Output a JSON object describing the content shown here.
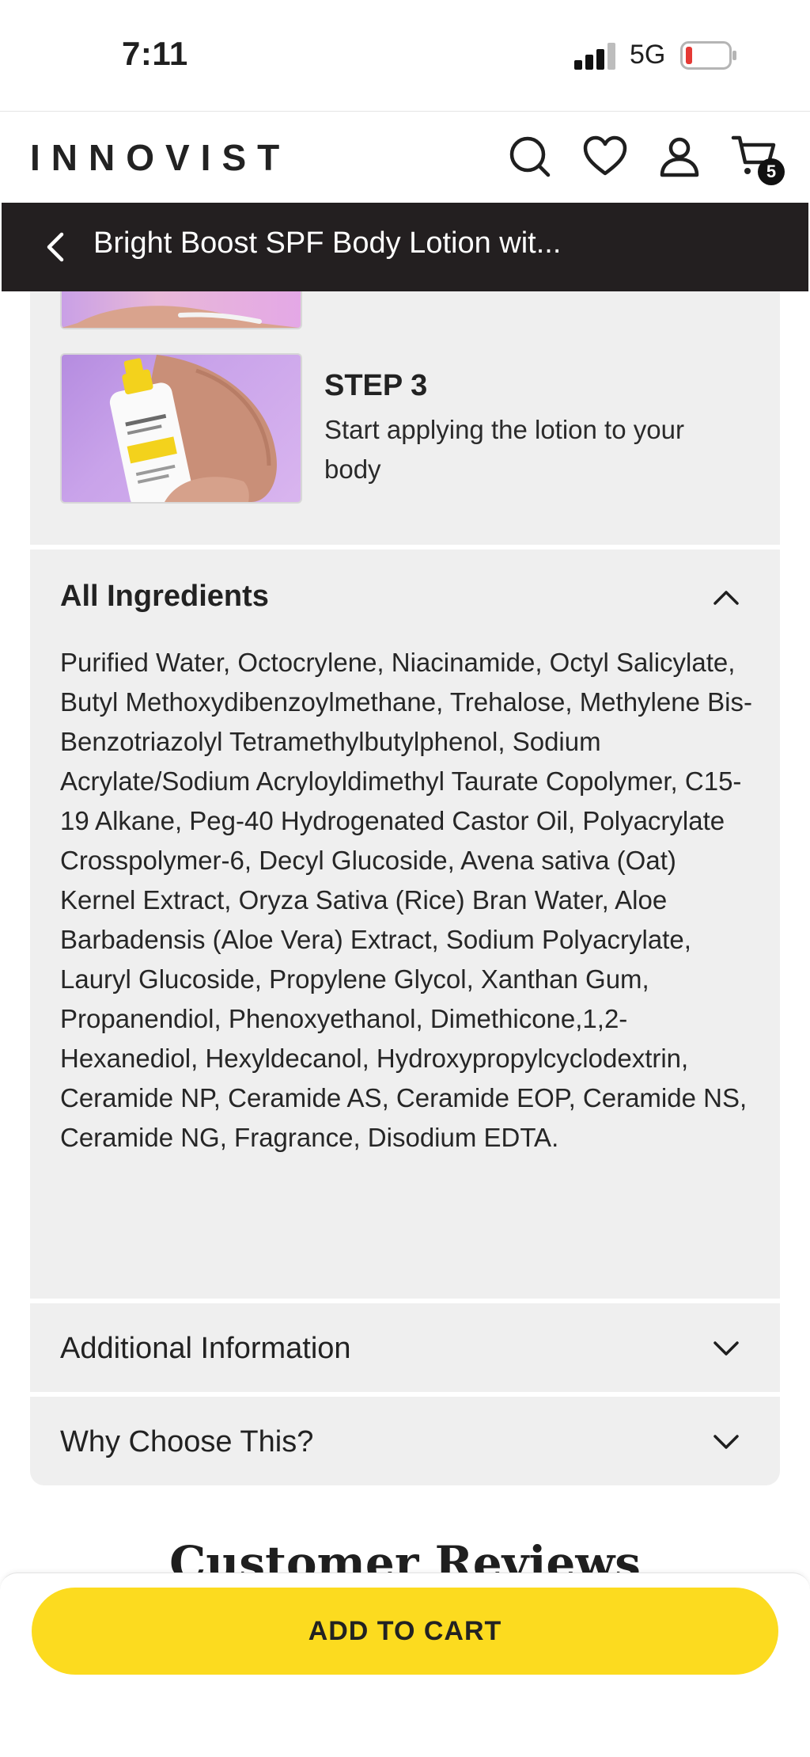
{
  "status_bar": {
    "time": "7:11",
    "network": "5G"
  },
  "header": {
    "logo": "INNOVIST",
    "cart_count": "5"
  },
  "title_bar": {
    "title": "Bright Boost SPF Body Lotion wit..."
  },
  "steps": [
    {
      "label": "STEP 3",
      "text": "Start applying the lotion to your body"
    }
  ],
  "accordions": {
    "ingredients": {
      "title": "All Ingredients",
      "body": "Purified Water, Octocrylene, Niacinamide, Octyl Salicylate, Butyl Methoxydibenzoylmethane, Trehalose, Methylene Bis-Benzotriazolyl Tetramethylbutylphenol, Sodium Acrylate/Sodium Acryloyldimethyl Taurate Copolymer, C15-19 Alkane, Peg-40 Hydrogenated Castor Oil, Polyacrylate Crosspolymer-6, Decyl Glucoside, Avena sativa (Oat) Kernel Extract, Oryza Sativa (Rice) Bran Water, Aloe Barbadensis (Aloe Vera) Extract, Sodium Polyacrylate, Lauryl Glucoside, Propylene Glycol, Xanthan Gum, Propanendiol, Phenoxyethanol, Dimethicone,1,2-Hexanediol, Hexyldecanol, Hydroxypropylcyclodextrin, Ceramide NP, Ceramide AS, Ceramide EOP, Ceramide NS, Ceramide NG, Fragrance, Disodium EDTA."
    },
    "additional": {
      "title": "Additional Information"
    },
    "why": {
      "title": "Why Choose This?"
    }
  },
  "reviews": {
    "heading": "Customer Reviews"
  },
  "cta": {
    "label": "ADD TO CART"
  },
  "colors": {
    "accent": "#fcdb1f",
    "title_bar": "#231f20",
    "panel": "#efefef"
  }
}
